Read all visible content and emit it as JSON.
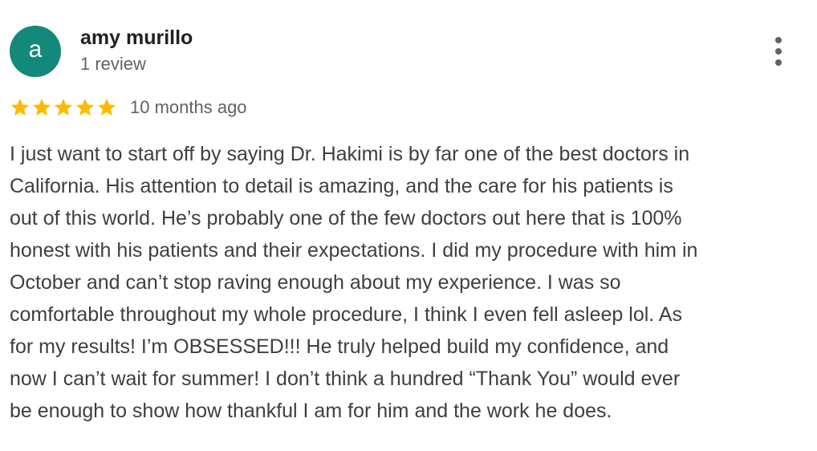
{
  "reviewer": {
    "avatar_letter": "a",
    "avatar_color": "#12897a",
    "name": "amy murillo",
    "review_count": "1 review"
  },
  "menu": {
    "icon": "more-vert-icon"
  },
  "rating": {
    "stars": 5,
    "max_stars": 5,
    "star_color": "#fbbc04",
    "star_icon": "star-icon",
    "date": "10 months ago"
  },
  "review": {
    "lines": [
      "I just want to start off by saying Dr. Hakimi is by far one of the best doctors in",
      "California. His attention to detail is amazing, and the care for his patients is",
      "out of this world. He’s probably one of the few doctors out here that is 100%",
      "honest with his patients and their expectations. I did my procedure with him in",
      "October and can’t stop raving enough about my experience. I was so",
      "comfortable throughout my whole procedure, I think I even fell asleep lol. As",
      "for my results! I’m OBSESSED!!! He truly helped build my confidence, and",
      "now I can’t wait for summer! I don’t think a hundred “Thank You” would ever",
      "be enough to show how thankful I am for him and the work he does."
    ]
  }
}
